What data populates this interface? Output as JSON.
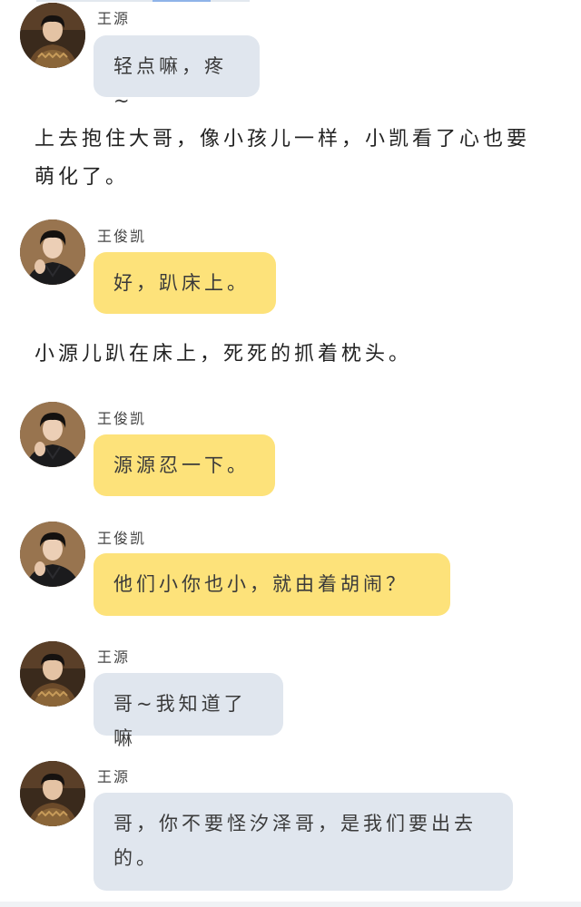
{
  "messages": [
    {
      "type": "chat",
      "sender": "王源",
      "text": "轻点嘛，疼~",
      "bubble_color": "#e0e6ee"
    },
    {
      "type": "narration",
      "text": "上去抱住大哥，像小孩儿一样，小凯看了心也要萌化了。"
    },
    {
      "type": "chat",
      "sender": "王俊凯",
      "text": "好，趴床上。",
      "bubble_color": "#fde27a"
    },
    {
      "type": "narration",
      "text": "小源儿趴在床上，死死的抓着枕头。"
    },
    {
      "type": "chat",
      "sender": "王俊凯",
      "text": "源源忍一下。",
      "bubble_color": "#fde27a"
    },
    {
      "type": "chat",
      "sender": "王俊凯",
      "text": "他们小你也小，就由着胡闹？",
      "bubble_color": "#fde27a"
    },
    {
      "type": "chat",
      "sender": "王源",
      "text": "哥~我知道了嘛",
      "bubble_color": "#e0e6ee"
    },
    {
      "type": "chat",
      "sender": "王源",
      "text": "哥，你不要怪汐泽哥，是我们要出去的。",
      "bubble_color": "#e0e6ee"
    }
  ],
  "icons": {
    "avatar_wangyuan": "avatar-wangyuan-icon",
    "avatar_wangjunkai": "avatar-wangjunkai-icon"
  }
}
